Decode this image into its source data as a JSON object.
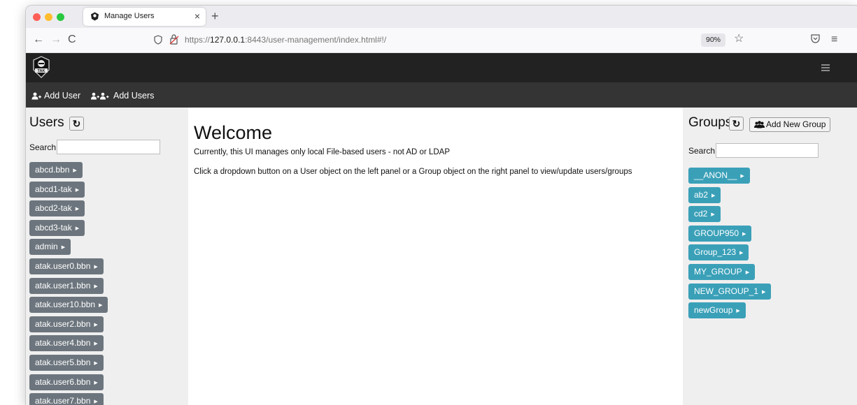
{
  "browser": {
    "tab_title": "Manage Users",
    "tab_close": "×",
    "new_tab": "+",
    "nav": {
      "back": "←",
      "forward": "→",
      "reload": "C"
    },
    "url_prefix": "https://",
    "url_host": "127.0.0.1",
    "url_rest": ":8443/user-management/index.html#!/",
    "zoom": "90%",
    "star": "☆",
    "menu": "≡"
  },
  "app": {
    "logo_text": "TAK",
    "subnav": {
      "add_user": "Add User",
      "add_users": "Add Users"
    }
  },
  "users_panel": {
    "title": "Users",
    "refresh": "↻",
    "search_label": "Search",
    "search_value": "",
    "users": [
      "abcd.bbn",
      "abcd1-tak",
      "abcd2-tak",
      "abcd3-tak",
      "admin",
      "atak.user0.bbn",
      "atak.user1.bbn",
      "atak.user10.bbn",
      "atak.user2.bbn",
      "atak.user4.bbn",
      "atak.user5.bbn",
      "atak.user6.bbn",
      "atak.user7.bbn"
    ]
  },
  "main": {
    "title": "Welcome",
    "line1": "Currently, this UI manages only local File-based users - not AD or LDAP",
    "line2": "Click a dropdown button on a User object on the left panel or a Group object on the right panel to view/update users/groups"
  },
  "groups_panel": {
    "title": "Groups",
    "refresh": "↻",
    "add_group_label": "Add New Group",
    "search_label": "Search",
    "search_value": "",
    "groups": [
      "__ANON__",
      "ab2",
      "cd2",
      "GROUP950",
      "Group_123",
      "MY_GROUP",
      "NEW_GROUP_1",
      "newGroup"
    ]
  },
  "colors": {
    "user_pill": "#6c757d",
    "group_pill": "#3aa0b8",
    "header": "#222222",
    "subnav": "#343434"
  }
}
